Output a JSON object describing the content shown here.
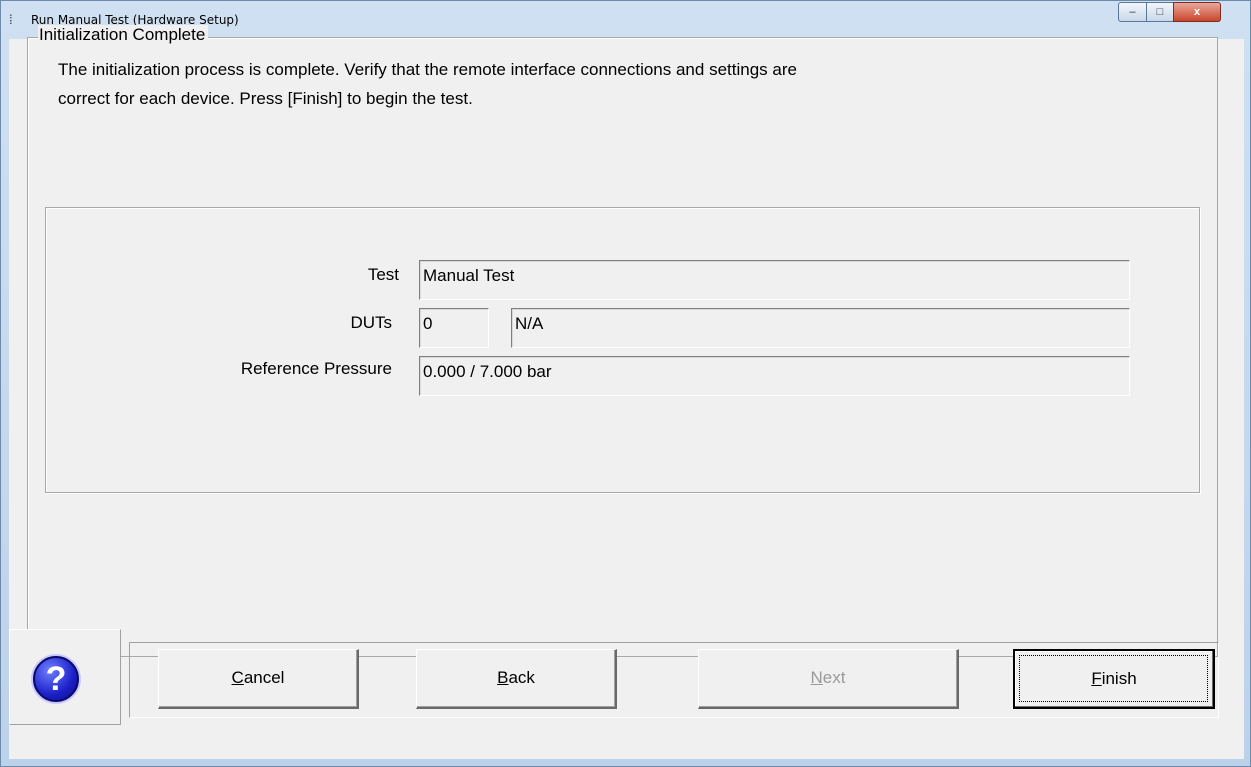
{
  "window": {
    "title": "Run Manual Test (Hardware Setup)",
    "app_icon": "tree-icon",
    "controls": {
      "minimize": "–",
      "maximize": "□",
      "close": "x"
    }
  },
  "group": {
    "title": "Initialization Complete",
    "line1": "The initialization process is complete.  Verify that the remote interface connections and settings are",
    "line2": "correct for each device.   Press [Finish] to begin the test."
  },
  "fields": {
    "test_label": "Test",
    "test_value": "Manual Test",
    "duts_label": "DUTs",
    "duts_count": "0",
    "duts_value": "N/A",
    "ref_label": "Reference Pressure",
    "ref_value": "0.000 / 7.000 bar"
  },
  "buttons": {
    "help": "?",
    "cancel_first": "C",
    "cancel_rest": "ancel",
    "back_first": "B",
    "back_rest": "ack",
    "next_first": "N",
    "next_rest": "ext",
    "finish_first": "F",
    "finish_rest": "inish"
  },
  "colors": {
    "help_blue": "#1c20c8",
    "disabled_text": "#9a9a9a",
    "dialog_bg": "#f0f0f0"
  }
}
